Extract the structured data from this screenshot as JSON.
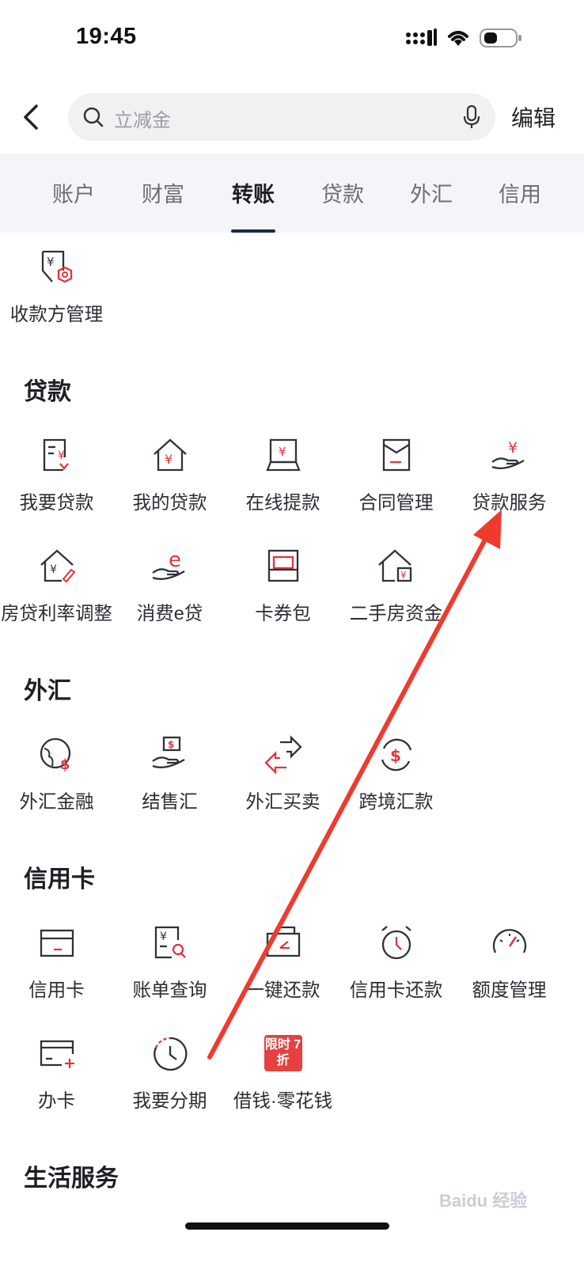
{
  "status_bar": {
    "time": "19:45"
  },
  "header": {
    "search_placeholder": "立减金",
    "edit_label": "编辑"
  },
  "tabs": [
    {
      "label": "账户"
    },
    {
      "label": "财富"
    },
    {
      "label": "转账",
      "active": true
    },
    {
      "label": "贷款"
    },
    {
      "label": "外汇"
    },
    {
      "label": "信用"
    }
  ],
  "transfer_section": {
    "items": [
      {
        "label": "收款方管理",
        "icon": "payee-manage-icon"
      }
    ]
  },
  "loan_section": {
    "title": "贷款",
    "items": [
      {
        "label": "我要贷款",
        "icon": "loan-apply-icon"
      },
      {
        "label": "我的贷款",
        "icon": "my-loan-icon"
      },
      {
        "label": "在线提款",
        "icon": "online-withdraw-icon"
      },
      {
        "label": "合同管理",
        "icon": "contract-icon"
      },
      {
        "label": "贷款服务",
        "icon": "loan-service-icon"
      },
      {
        "label": "房贷利率调整",
        "icon": "mortgage-rate-icon"
      },
      {
        "label": "消费e贷",
        "icon": "consumer-loan-icon"
      },
      {
        "label": "卡券包",
        "icon": "coupon-wallet-icon"
      },
      {
        "label": "二手房资金",
        "icon": "second-hand-house-icon"
      }
    ]
  },
  "forex_section": {
    "title": "外汇",
    "items": [
      {
        "label": "外汇金融",
        "icon": "forex-finance-icon"
      },
      {
        "label": "结售汇",
        "icon": "exchange-settlement-icon"
      },
      {
        "label": "外汇买卖",
        "icon": "forex-trade-icon"
      },
      {
        "label": "跨境汇款",
        "icon": "cross-border-icon"
      }
    ]
  },
  "credit_section": {
    "title": "信用卡",
    "items": [
      {
        "label": "信用卡",
        "icon": "credit-card-icon"
      },
      {
        "label": "账单查询",
        "icon": "bill-query-icon"
      },
      {
        "label": "一键还款",
        "icon": "one-click-repay-icon"
      },
      {
        "label": "信用卡还款",
        "icon": "card-repay-icon"
      },
      {
        "label": "额度管理",
        "icon": "limit-gauge-icon"
      },
      {
        "label": "办卡",
        "icon": "apply-card-icon"
      },
      {
        "label": "我要分期",
        "icon": "installment-icon"
      },
      {
        "label": "借钱·零花钱",
        "icon": "promo-badge",
        "badge": "限时 7折"
      }
    ]
  },
  "life_section": {
    "title": "生活服务"
  },
  "watermark": "Baidu 经验",
  "colors": {
    "accent_red": "#e2353b",
    "icon_dark": "#2f3237",
    "tab_underline": "#1d2747"
  }
}
